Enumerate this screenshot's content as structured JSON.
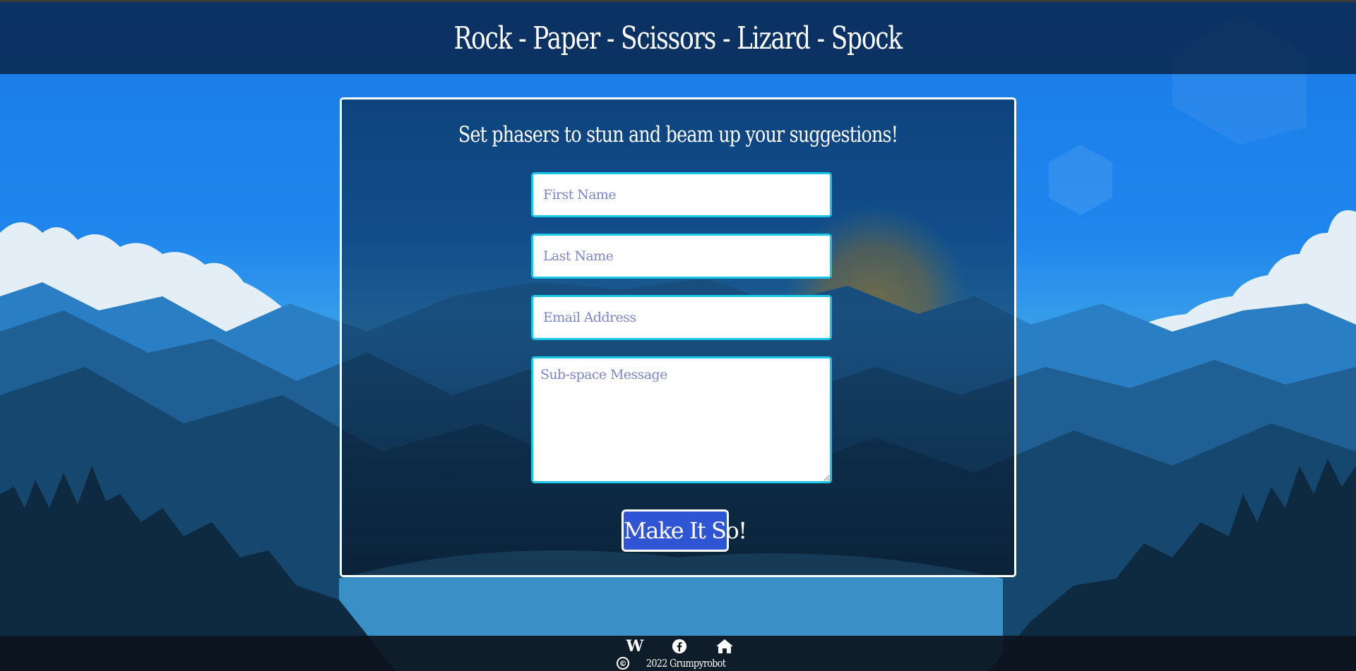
{
  "header": {
    "title": "Rock - Paper - Scissors - Lizard - Spock"
  },
  "form": {
    "heading": "Set phasers to stun and beam up your suggestions!",
    "first_name_placeholder": "First Name",
    "last_name_placeholder": "Last Name",
    "email_placeholder": "Email Address",
    "message_placeholder": "Sub-space Message",
    "submit_label": "Make It So!"
  },
  "footer": {
    "social": [
      {
        "name": "wikipedia",
        "icon": "wikipedia-icon",
        "glyph": "W"
      },
      {
        "name": "facebook",
        "icon": "facebook-icon"
      },
      {
        "name": "home",
        "icon": "home-icon"
      }
    ],
    "copyright_symbol": "©",
    "copyright_text": "2022 Grumpyrobot"
  },
  "colors": {
    "header_bg": "#0a2a4d",
    "field_border": "#19c6e6",
    "submit_bg": "#2f55d4",
    "placeholder": "#7d86c9",
    "footer_bg": "#0c141c"
  }
}
